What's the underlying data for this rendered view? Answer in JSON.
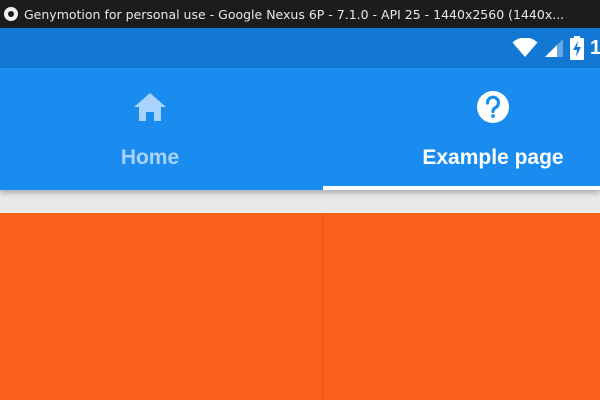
{
  "window": {
    "title": "Genymotion for personal use - Google Nexus 6P - 7.1.0 - API 25 - 1440x2560 (1440x...",
    "icon": "genymotion-app-icon"
  },
  "status_bar": {
    "icons": [
      "wifi-icon",
      "cell-signal-icon",
      "battery-charging-icon"
    ],
    "clock": "1"
  },
  "tabs": [
    {
      "label": "Home",
      "icon": "home-icon",
      "selected": false
    },
    {
      "label": "Example page",
      "icon": "help-circle-icon",
      "selected": true
    }
  ],
  "colors": {
    "status_bar": "#1278d4",
    "tab_bar": "#1a8cf0",
    "inactive_tab": "#a9d3fb",
    "active_tab": "#ffffff",
    "content": "#fb611c"
  }
}
